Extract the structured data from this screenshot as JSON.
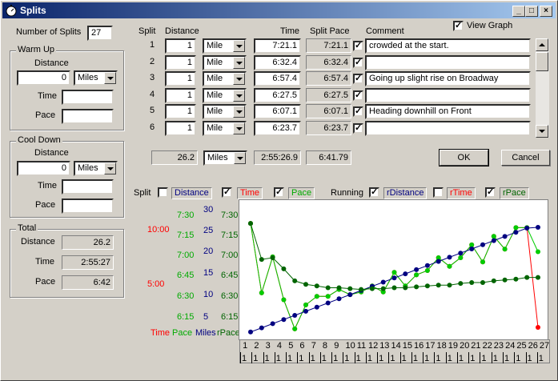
{
  "window": {
    "title": "Splits",
    "minimize": "_",
    "maximize": "□",
    "close": "×"
  },
  "left": {
    "num_splits_label": "Number of Splits",
    "num_splits": "27",
    "warmup": {
      "title": "Warm Up",
      "distance_label": "Distance",
      "distance": "0",
      "unit": "Miles",
      "time_label": "Time",
      "time": "",
      "pace_label": "Pace",
      "pace": ""
    },
    "cooldown": {
      "title": "Cool Down",
      "distance_label": "Distance",
      "distance": "0",
      "unit": "Miles",
      "time_label": "Time",
      "time": "",
      "pace_label": "Pace",
      "pace": ""
    },
    "total": {
      "title": "Total",
      "distance_label": "Distance",
      "distance": "26.2",
      "time_label": "Time",
      "time": "2:55:27",
      "pace_label": "Pace",
      "pace": "6:42"
    }
  },
  "grid": {
    "headers": {
      "split": "Split",
      "distance": "Distance",
      "time": "Time",
      "split_pace": "Split Pace",
      "comment": "Comment"
    },
    "view_graph": "View Graph",
    "rows": [
      {
        "n": "1",
        "distance": "1",
        "unit": "Mile",
        "time": "7:21.1",
        "pace": "7:21.1",
        "comment": "crowded at the start."
      },
      {
        "n": "2",
        "distance": "1",
        "unit": "Mile",
        "time": "6:32.4",
        "pace": "6:32.4",
        "comment": ""
      },
      {
        "n": "3",
        "distance": "1",
        "unit": "Mile",
        "time": "6:57.4",
        "pace": "6:57.4",
        "comment": "Going up slight rise on Broadway"
      },
      {
        "n": "4",
        "distance": "1",
        "unit": "Mile",
        "time": "6:27.5",
        "pace": "6:27.5",
        "comment": ""
      },
      {
        "n": "5",
        "distance": "1",
        "unit": "Mile",
        "time": "6:07.1",
        "pace": "6:07.1",
        "comment": "Heading downhill on Front"
      },
      {
        "n": "6",
        "distance": "1",
        "unit": "Mile",
        "time": "6:23.7",
        "pace": "6:23.7",
        "comment": ""
      }
    ],
    "totals": {
      "distance": "26.2",
      "unit": "Miles",
      "time": "2:55:26.9",
      "pace": "6:41.79"
    },
    "ok": "OK",
    "cancel": "Cancel"
  },
  "legend": {
    "split": "Split",
    "distance": "Distance",
    "time": "Time",
    "pace": "Pace",
    "running": "Running",
    "rdistance": "rDistance",
    "rtime": "rTime",
    "rpace": "rPace"
  },
  "axes": {
    "time_ticks": [
      "10:00",
      "5:00"
    ],
    "pace_ticks": [
      "7:30",
      "7:15",
      "7:00",
      "6:45",
      "6:30",
      "6:15"
    ],
    "miles_ticks": [
      "30",
      "25",
      "20",
      "15",
      "10",
      "5"
    ],
    "rpace_ticks": [
      "7:30",
      "7:15",
      "7:00",
      "6:45",
      "6:30",
      "6:15"
    ],
    "bottom": {
      "time": "Time",
      "pace": "Pace",
      "miles": "Miles",
      "rpace": "rPace"
    },
    "x_labels": [
      "1",
      "2",
      "3",
      "4",
      "5",
      "6",
      "7",
      "8",
      "9",
      "10",
      "11",
      "12",
      "13",
      "14",
      "15",
      "16",
      "17",
      "18",
      "19",
      "20",
      "21",
      "22",
      "23",
      "24",
      "25",
      "26",
      "27"
    ],
    "x_sub": [
      "1",
      "1",
      "1",
      "1",
      "1",
      "1",
      "1",
      "1",
      "1",
      "1",
      "1",
      "1",
      "1",
      "1",
      "1",
      "1",
      "1",
      "1",
      "1",
      "1",
      "1",
      "1",
      "1",
      "1",
      "1",
      "1",
      "1"
    ]
  },
  "chart_data": {
    "type": "line",
    "x": [
      1,
      2,
      3,
      4,
      5,
      6,
      7,
      8,
      9,
      10,
      11,
      12,
      13,
      14,
      15,
      16,
      17,
      18,
      19,
      20,
      21,
      22,
      23,
      24,
      25,
      26,
      27
    ],
    "series": [
      {
        "name": "Time",
        "color": "#ff0000",
        "values": [
          7.35,
          6.54,
          6.96,
          6.46,
          6.12,
          6.4,
          6.5,
          6.5,
          6.58,
          6.52,
          6.55,
          6.62,
          6.55,
          6.78,
          6.62,
          6.75,
          6.8,
          6.95,
          6.85,
          6.95,
          7.1,
          6.9,
          7.2,
          7.05,
          7.3,
          7.3,
          2.0
        ]
      },
      {
        "name": "Pace",
        "color": "#00cc00",
        "values": [
          7.35,
          6.54,
          6.96,
          6.46,
          6.12,
          6.4,
          6.5,
          6.5,
          6.58,
          6.52,
          6.55,
          6.62,
          6.55,
          6.78,
          6.62,
          6.75,
          6.8,
          6.95,
          6.85,
          6.95,
          7.1,
          6.9,
          7.2,
          7.05,
          7.3,
          7.3,
          7.02
        ]
      },
      {
        "name": "rDistance",
        "color": "#000080",
        "values": [
          1,
          2,
          3,
          4,
          5,
          6,
          7,
          8,
          9,
          10,
          11,
          12,
          13,
          14,
          15,
          16,
          17,
          18,
          19,
          20,
          21,
          22,
          23,
          24,
          25,
          26,
          26.2
        ]
      },
      {
        "name": "rPace",
        "color": "#006400",
        "values": [
          7.35,
          6.93,
          6.95,
          6.82,
          6.68,
          6.64,
          6.62,
          6.6,
          6.6,
          6.59,
          6.58,
          6.59,
          6.59,
          6.6,
          6.6,
          6.61,
          6.62,
          6.63,
          6.63,
          6.65,
          6.66,
          6.66,
          6.68,
          6.69,
          6.7,
          6.72,
          6.72
        ]
      }
    ]
  }
}
